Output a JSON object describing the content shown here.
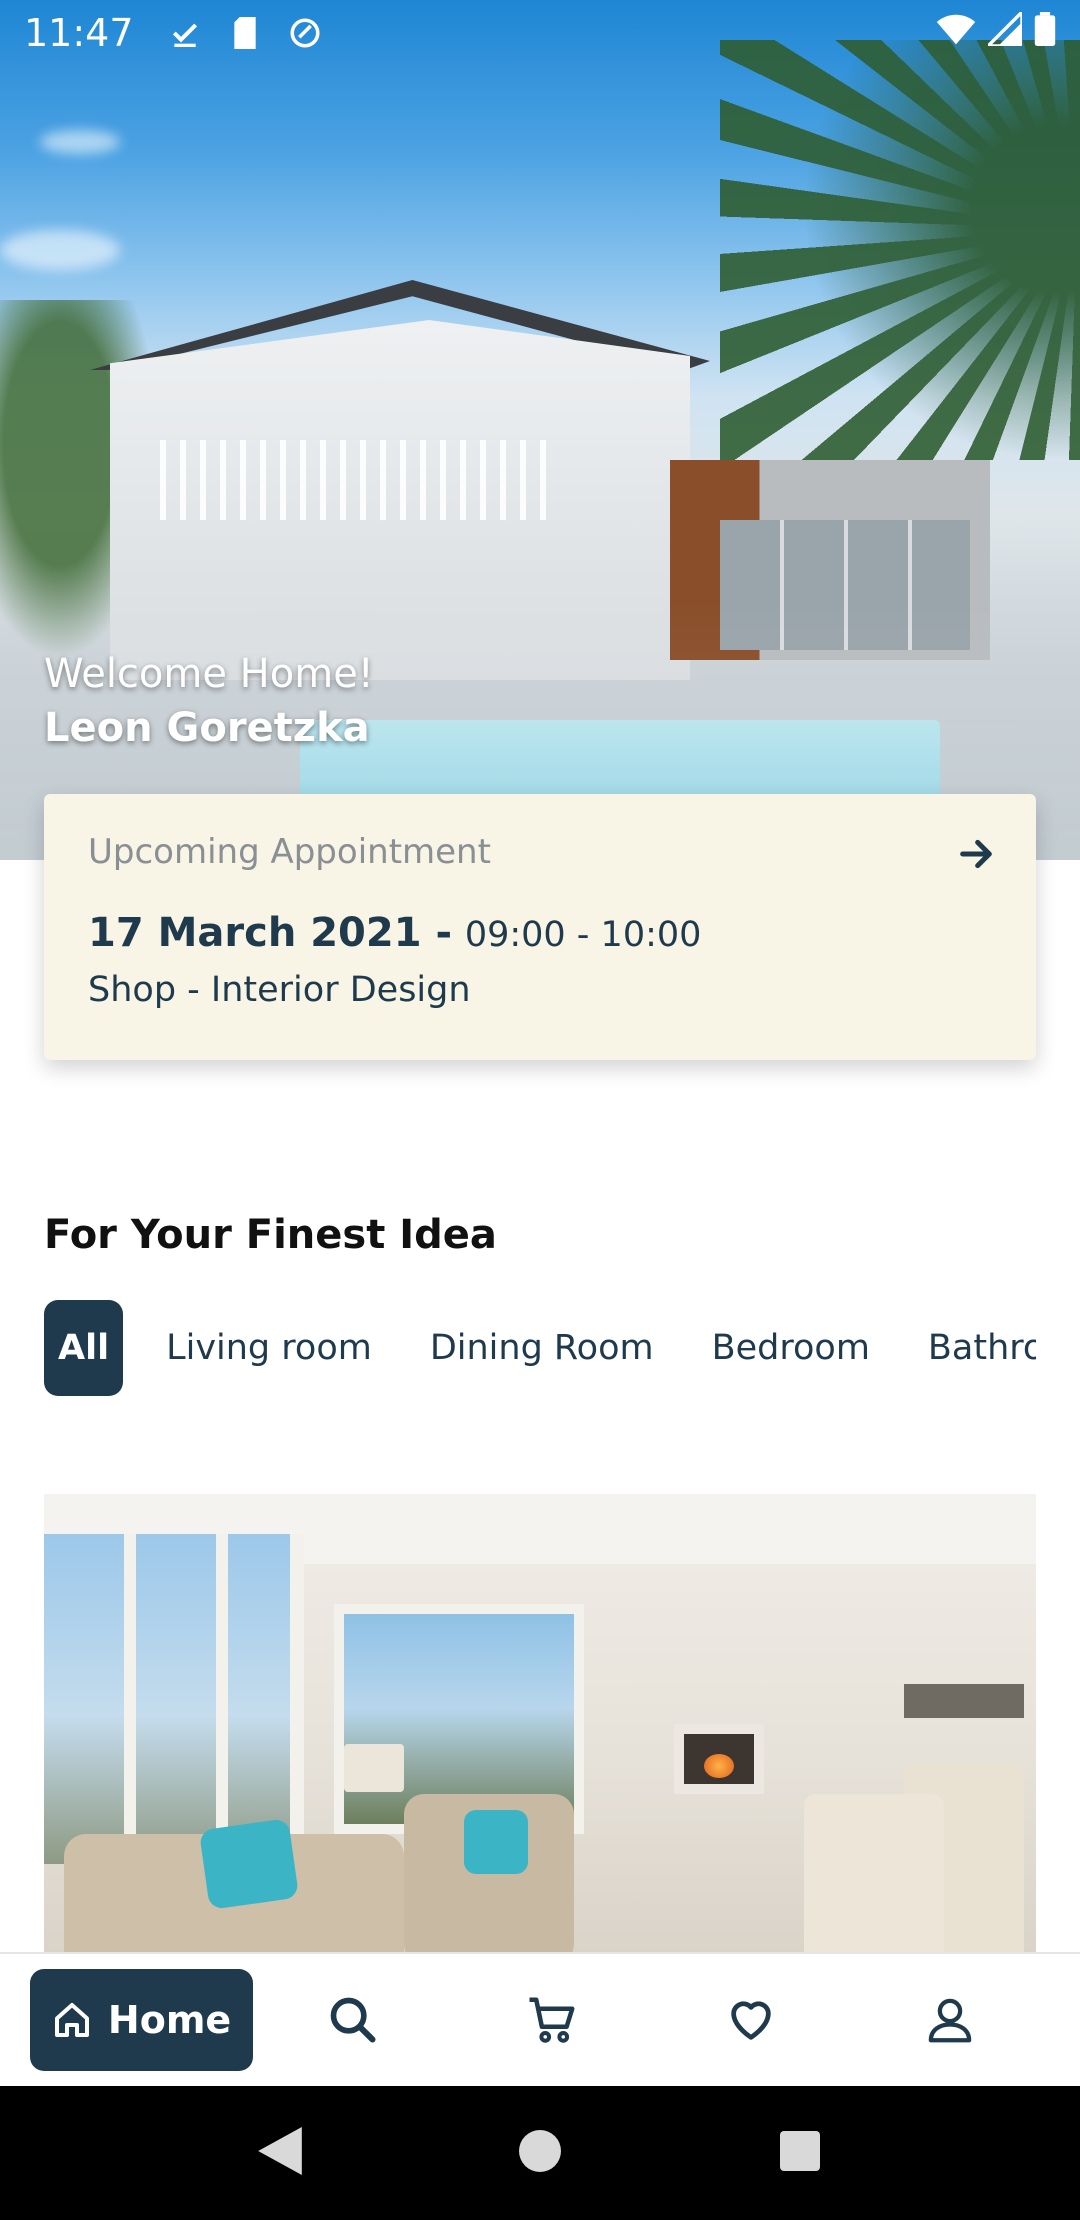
{
  "status_bar": {
    "time": "11:47",
    "icons": [
      "download-done-icon",
      "sd-card-icon",
      "sync-icon",
      "wifi-icon",
      "cell-signal-icon",
      "battery-icon"
    ]
  },
  "hero": {
    "welcome": "Welcome Home!",
    "user_name": "Leon Goretzka"
  },
  "appointment": {
    "label": "Upcoming Appointment",
    "date": "17 March 2021 -",
    "time": "09:00 - 10:00",
    "place": "Shop - Interior Design",
    "arrow_icon": "arrow-right-icon"
  },
  "section": {
    "title": "For Your Finest Idea",
    "categories": [
      "All",
      "Living room",
      "Dining Room",
      "Bedroom",
      "Bathroom"
    ],
    "active_index": 0
  },
  "bottom_nav": {
    "home_label": "Home",
    "items": [
      "home-icon",
      "search-icon",
      "cart-icon",
      "heart-icon",
      "profile-icon"
    ]
  },
  "colors": {
    "primary": "#1f3a4d",
    "card_bg": "#f8f4e6",
    "accent_teal": "#3bb5c6"
  }
}
